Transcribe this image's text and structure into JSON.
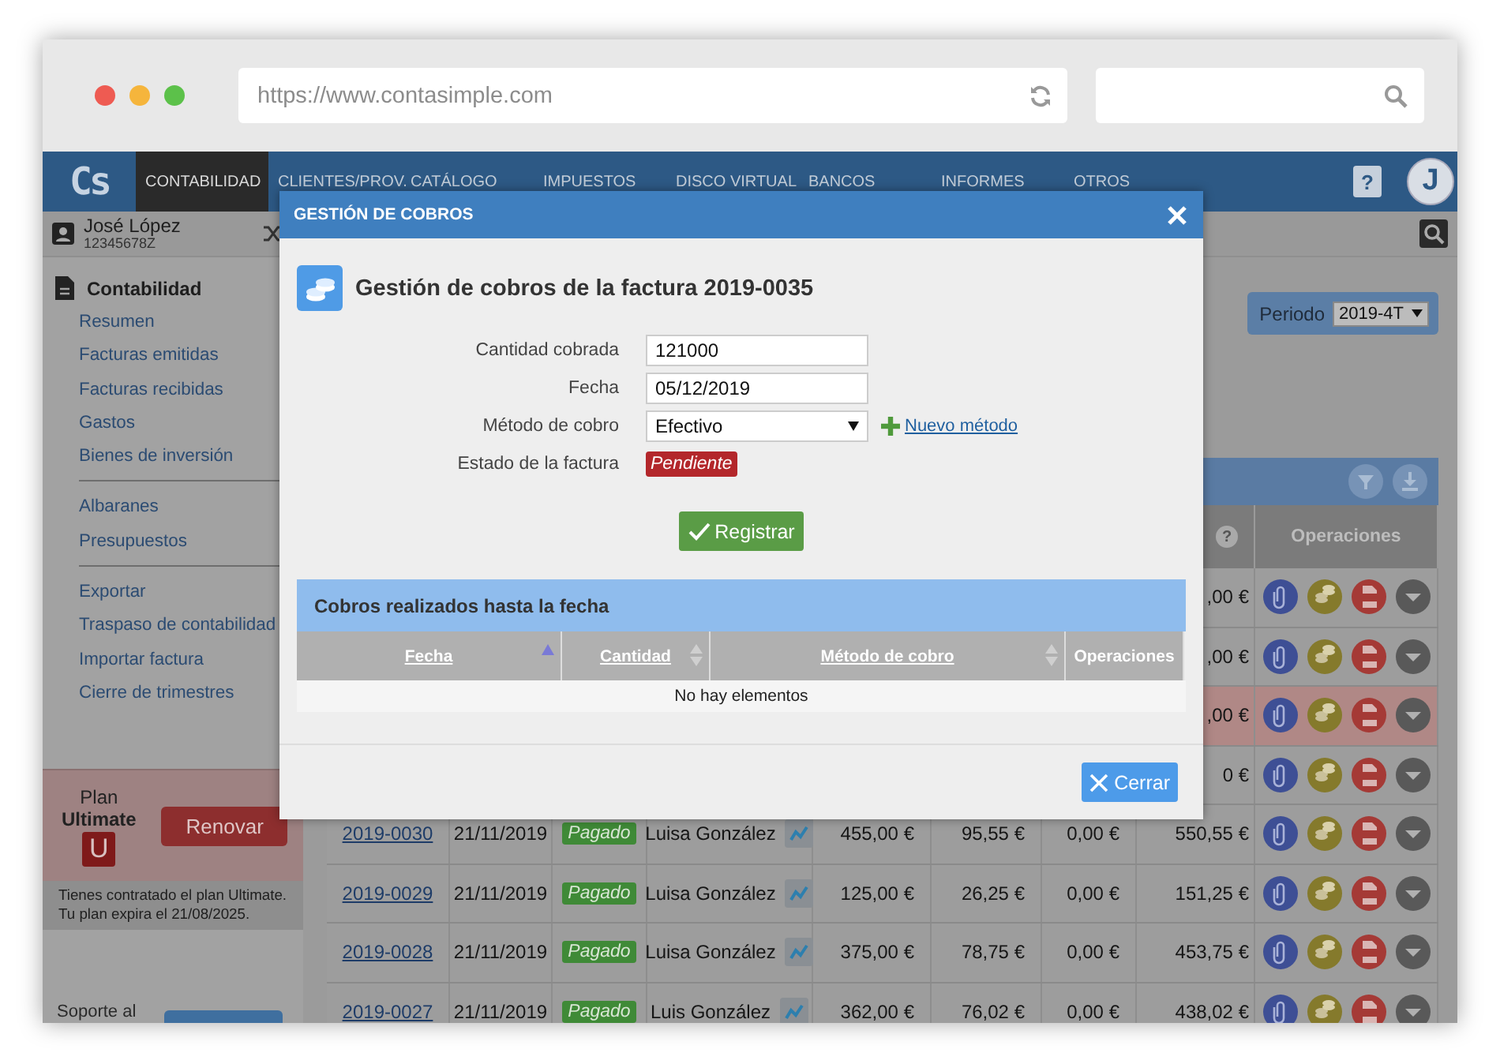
{
  "browser": {
    "url": "https://www.contasimple.com"
  },
  "nav": {
    "logo": "Cs",
    "items": [
      {
        "label": "CONTABILIDAD",
        "selected": true
      },
      {
        "label": "CLIENTES/PROV.",
        "selected": false
      },
      {
        "label": "CATÁLOGO",
        "selected": false
      },
      {
        "label": "IMPUESTOS",
        "selected": false
      },
      {
        "label": "DISCO VIRTUAL",
        "selected": false
      },
      {
        "label": "BANCOS",
        "selected": false
      },
      {
        "label": "INFORMES",
        "selected": false
      },
      {
        "label": "OTROS",
        "selected": false
      }
    ],
    "help_icon": "?",
    "avatar": "J"
  },
  "user": {
    "name": "José López",
    "id": "12345678Z"
  },
  "sidebar": {
    "section": "Contabilidad",
    "groups": [
      [
        {
          "label": "Resumen"
        },
        {
          "label": "Facturas emitidas"
        },
        {
          "label": "Facturas recibidas"
        },
        {
          "label": "Gastos"
        },
        {
          "label": "Bienes de inversión"
        }
      ],
      [
        {
          "label": "Albaranes"
        },
        {
          "label": "Presupuestos"
        }
      ],
      [
        {
          "label": "Exportar"
        },
        {
          "label": "Traspaso de contabilidad"
        },
        {
          "label": "Importar factura"
        },
        {
          "label": "Cierre de trimestres"
        }
      ]
    ]
  },
  "plan": {
    "label": "Plan",
    "name": "Ultimate",
    "badge": "U",
    "button": "Renovar",
    "notes": [
      "Tienes contratado el plan Ultimate.",
      "Tu plan expira el 21/08/2025."
    ]
  },
  "support": {
    "label": "Soporte al"
  },
  "period": {
    "label": "Periodo",
    "value": "2019-4T"
  },
  "table": {
    "help_icon": "?",
    "columns": [
      {
        "label": "Operaciones"
      }
    ],
    "rows": [
      {
        "total": ",00 €",
        "highlighted": false
      },
      {
        "total": ",00 €",
        "highlighted": false
      },
      {
        "total": ",00 €",
        "highlighted": true
      },
      {
        "total": "0 €",
        "highlighted": false
      },
      {
        "invoice": "2019-0030",
        "date": "21/11/2019",
        "status": {
          "label": "Pagado",
          "kind": "paid"
        },
        "client": "Luisa González",
        "base": "455,00 €",
        "iva": "95,55 €",
        "retention": "0,00 €",
        "total": "550,55 €",
        "highlighted": false
      },
      {
        "invoice": "2019-0029",
        "date": "21/11/2019",
        "status": {
          "label": "Pagado",
          "kind": "paid"
        },
        "client": "Luisa González",
        "base": "125,00 €",
        "iva": "26,25 €",
        "retention": "0,00 €",
        "total": "151,25 €",
        "highlighted": false
      },
      {
        "invoice": "2019-0028",
        "date": "21/11/2019",
        "status": {
          "label": "Pagado",
          "kind": "paid"
        },
        "client": "Luisa González",
        "base": "375,00 €",
        "iva": "78,75 €",
        "retention": "0,00 €",
        "total": "453,75 €",
        "highlighted": false
      },
      {
        "invoice": "2019-0027",
        "date": "21/11/2019",
        "status": {
          "label": "Pagado",
          "kind": "paid"
        },
        "client": "Luis González",
        "base": "362,00 €",
        "iva": "76,02 €",
        "retention": "0,00 €",
        "total": "438,02 €",
        "highlighted": false
      }
    ]
  },
  "modal": {
    "title": "GESTIÓN DE COBROS",
    "heading": "Gestión de cobros de la factura 2019-0035",
    "fields": [
      {
        "kind": "text",
        "label": "Cantidad cobrada",
        "value": "121000"
      },
      {
        "kind": "text",
        "label": "Fecha",
        "value": "05/12/2019"
      },
      {
        "kind": "select",
        "label": "Método de cobro",
        "value": "Efectivo",
        "link": "Nuevo método"
      },
      {
        "kind": "status",
        "label": "Estado de la factura",
        "status": {
          "label": "Pendiente",
          "kind": "pending"
        }
      }
    ],
    "submit": "Registrar",
    "payments": {
      "title": "Cobros realizados hasta la fecha",
      "columns": [
        {
          "label": "Fecha",
          "sortable": true,
          "sorted": true
        },
        {
          "label": "Cantidad",
          "sortable": true,
          "sorted": false
        },
        {
          "label": "Método de cobro",
          "sortable": true,
          "sorted": false
        },
        {
          "label": "Operaciones",
          "sortable": false,
          "sorted": false
        }
      ],
      "empty": "No hay elementos"
    },
    "close": "Cerrar"
  }
}
